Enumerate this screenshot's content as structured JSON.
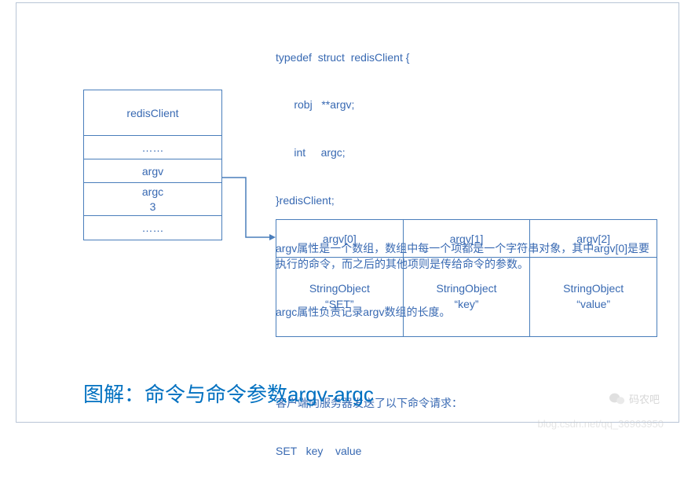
{
  "struct_table": {
    "title": "redisClient",
    "row_ellipsis1": "……",
    "row_argv": "argv",
    "row_argc_label": "argc",
    "row_argc_value": "3",
    "row_ellipsis2": "……"
  },
  "desc": {
    "code_line1": "typedef  struct  redisClient {",
    "code_line2": "      robj   **argv;",
    "code_line3": "      int     argc;",
    "code_line4": "}redisClient;",
    "para1": "argv属性是一个数组，数组中每一个项都是一个字符串对象，其中argv[0]是要执行的命令，而之后的其他项则是传给命令的参数。",
    "para2": "argc属性负责记录argv数组的长度。",
    "para3_line1": "客户端向服务器发送了以下命令请求：",
    "para3_line2": "SET   key    value"
  },
  "argv_table": {
    "cols": [
      {
        "head": "argv[0]",
        "body_line1": "StringObject",
        "body_line2": "“SET”"
      },
      {
        "head": "argv[1]",
        "body_line1": "StringObject",
        "body_line2": "“key”"
      },
      {
        "head": "argv[2]",
        "body_line1": "StringObject",
        "body_line2": "“value”"
      }
    ]
  },
  "caption": "图解：命令与命令参数argv-argc",
  "watermark": {
    "name": "码农吧",
    "url": "blog.csdn.net/qq_36963950"
  }
}
